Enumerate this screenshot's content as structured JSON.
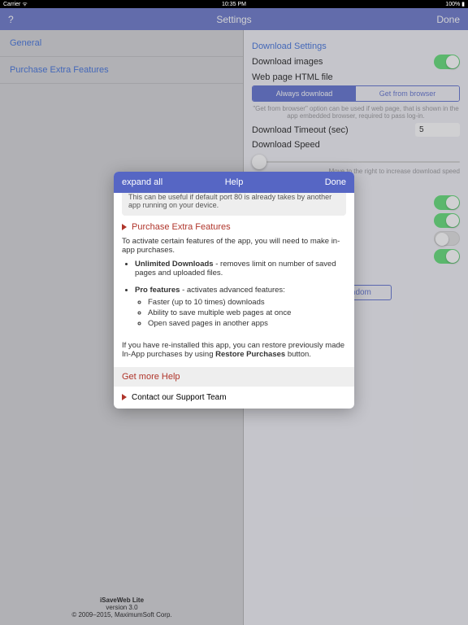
{
  "statusbar": {
    "carrier": "Carrier ᯤ",
    "time": "10:35 PM",
    "batt": "100% ▮"
  },
  "nav": {
    "help": "?",
    "title": "Settings",
    "done": "Done"
  },
  "sidebar": {
    "items": [
      {
        "label": "General"
      },
      {
        "label": "Purchase Extra Features"
      }
    ]
  },
  "content": {
    "sect": "Download Settings",
    "dl_images": "Download images",
    "html_file": "Web page HTML file",
    "seg": {
      "a": "Always download",
      "b": "Get from browser"
    },
    "hint1": "\"Get from browser\" option can be used if web page, that is shown in the app embedded browser, required to pass log-in.",
    "timeout_l": "Download Timeout (sec)",
    "timeout_v": "5",
    "speed_l": "Download Speed",
    "hint2": "Move to the right to increase download speed",
    "random": "Random"
  },
  "footer": {
    "name": "iSaveWeb Lite",
    "ver": "version 3.0",
    "cp": "© 2009–2015, MaximumSoft Corp."
  },
  "modal": {
    "nav": {
      "expand": "expand all",
      "title": "Help",
      "done": "Done"
    },
    "snippet": "This can be useful if default port 80 is already takes by another app running on your device.",
    "purchase": {
      "h": "Purchase Extra Features",
      "p1": "To activate certain features of the app, you will need to make in-app purchases.",
      "b1": "Unlimited Downloads",
      "b1t": " - removes limit on number of saved pages and uploaded files.",
      "b2": "Pro features",
      "b2t": " - activates advanced features:",
      "f1": "Faster (up to 10 times) downloads",
      "f2": "Ability to save multiple web pages at once",
      "f3": "Open saved pages in another apps",
      "p2a": "If you have re-installed this app, you can restore previously made In-App purchases by using ",
      "p2b": "Restore Purchases",
      "p2c": " button."
    },
    "gmh": "Get more Help",
    "contact": "Contact our Support Team"
  }
}
